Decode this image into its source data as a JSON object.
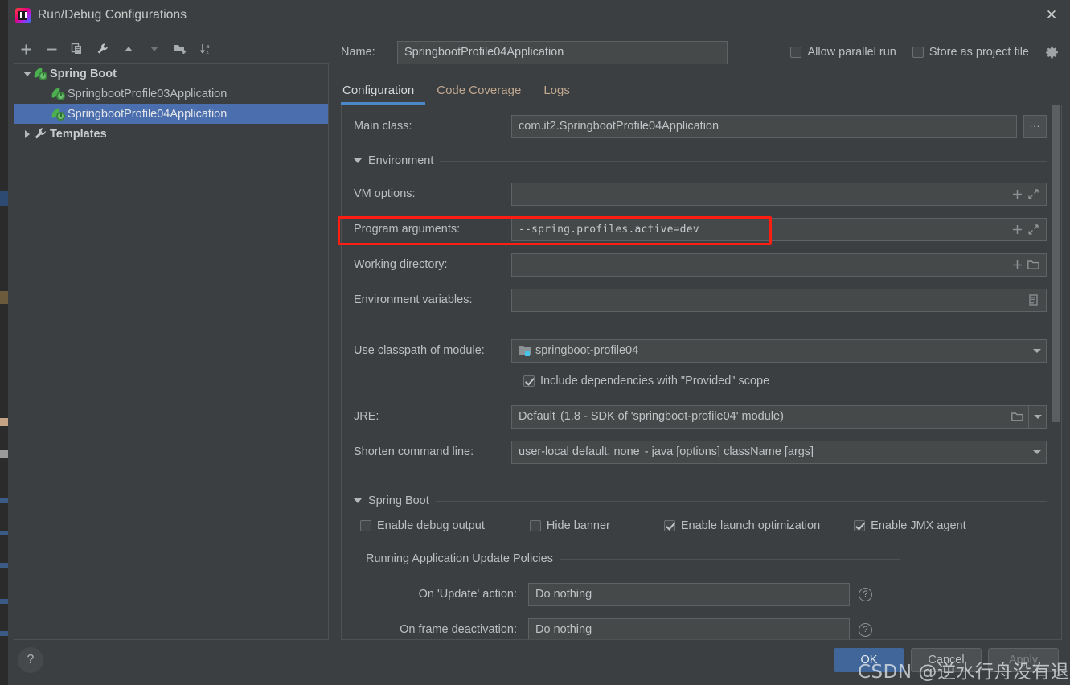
{
  "window": {
    "title": "Run/Debug Configurations",
    "app_icon": "intellij-idea-logo",
    "close_label": "✕"
  },
  "tree_toolbar": {
    "buttons": [
      {
        "name": "add-configuration",
        "icon": "plus-icon",
        "label": "+"
      },
      {
        "name": "remove-configuration",
        "icon": "minus-icon",
        "label": "−"
      },
      {
        "name": "copy-configuration",
        "icon": "copy-icon",
        "label": "Copy"
      },
      {
        "name": "edit-templates",
        "icon": "wrench-icon",
        "label": "Edit Templates"
      },
      {
        "name": "move-up",
        "icon": "arrow-up-icon",
        "label": "Move Up"
      },
      {
        "name": "move-down",
        "icon": "arrow-down-icon",
        "label": "Move Down"
      },
      {
        "name": "new-folder",
        "icon": "folder-add-icon",
        "label": "New Folder"
      },
      {
        "name": "sort-configurations",
        "icon": "sort-az-icon",
        "label": "Sort"
      }
    ]
  },
  "tree": {
    "nodes": [
      {
        "label": "Spring Boot",
        "icon": "spring-boot-icon",
        "level": 0,
        "expanded": true,
        "selected": false,
        "bold": true
      },
      {
        "label": "SpringbootProfile03Application",
        "icon": "spring-boot-icon",
        "level": 1,
        "selected": false,
        "bold": false
      },
      {
        "label": "SpringbootProfile04Application",
        "icon": "spring-boot-icon",
        "level": 1,
        "selected": true,
        "bold": false
      },
      {
        "label": "Templates",
        "icon": "wrench-icon",
        "level": 0,
        "expanded": false,
        "selected": false,
        "bold": true
      }
    ]
  },
  "header": {
    "name_label": "Name:",
    "name_value": "SpringbootProfile04Application",
    "allow_parallel_run": {
      "label": "Allow parallel run",
      "checked": false
    },
    "store_as_project_file": {
      "label": "Store as project file",
      "checked": false
    },
    "gear_icon": "gear-icon"
  },
  "tabs": [
    {
      "label": "Configuration",
      "active": true
    },
    {
      "label": "Code Coverage",
      "active": false
    },
    {
      "label": "Logs",
      "active": false
    }
  ],
  "form": {
    "main_class": {
      "label": "Main class:",
      "value": "com.it2.SpringbootProfile04Application",
      "browse_label": "..."
    },
    "environment_section": {
      "title": "Environment",
      "expanded": true
    },
    "vm_options": {
      "label": "VM options:",
      "value": "",
      "icons": [
        "plus-icon",
        "expand-icon"
      ]
    },
    "program_arguments": {
      "label": "Program arguments:",
      "value": "--spring.profiles.active=dev",
      "icons": [
        "plus-icon",
        "expand-icon"
      ],
      "highlight_color": "#ff1e11"
    },
    "working_directory": {
      "label": "Working directory:",
      "value": "",
      "icons": [
        "plus-icon",
        "folder-icon"
      ]
    },
    "environment_variables": {
      "label": "Environment variables:",
      "value": "",
      "icons": [
        "list-icon"
      ]
    },
    "use_classpath_of_module": {
      "label": "Use classpath of module:",
      "value": "springboot-profile04",
      "icon": "module-icon"
    },
    "include_provided_scope": {
      "label": "Include dependencies with \"Provided\" scope",
      "checked": true
    },
    "jre": {
      "label": "JRE:",
      "value_strong": "Default",
      "value_dim": "(1.8 - SDK of 'springboot-profile04' module)",
      "icons": [
        "folder-icon",
        "chevron-down-icon"
      ]
    },
    "shorten_command_line": {
      "label": "Shorten command line:",
      "value_strong": "user-local default: none",
      "value_dim": "- java [options] className [args]"
    },
    "spring_boot_section": {
      "title": "Spring Boot",
      "expanded": true
    },
    "spring_checkboxes": [
      {
        "label": "Enable debug output",
        "checked": false
      },
      {
        "label": "Hide banner",
        "checked": false
      },
      {
        "label": "Enable launch optimization",
        "checked": true
      },
      {
        "label": "Enable JMX agent",
        "checked": true
      }
    ],
    "update_policies_section": {
      "title": "Running Application Update Policies"
    },
    "on_update_action": {
      "label": "On 'Update' action:",
      "value": "Do nothing",
      "help": "?"
    },
    "on_frame_deactivation": {
      "label": "On frame deactivation:",
      "value": "Do nothing",
      "help": "?"
    }
  },
  "footer": {
    "help_label": "?",
    "ok_label": "OK",
    "cancel_label": "Cancel",
    "apply_label": "Apply"
  },
  "watermark": {
    "text": "CSDN @逆水行舟没有退路"
  },
  "colors": {
    "accent": "#4a88c7",
    "selection": "#4b6eaf",
    "primary_button": "#41679a",
    "annotation": "#ff1e11",
    "background": "#3c3f41",
    "field": "#45494a"
  }
}
